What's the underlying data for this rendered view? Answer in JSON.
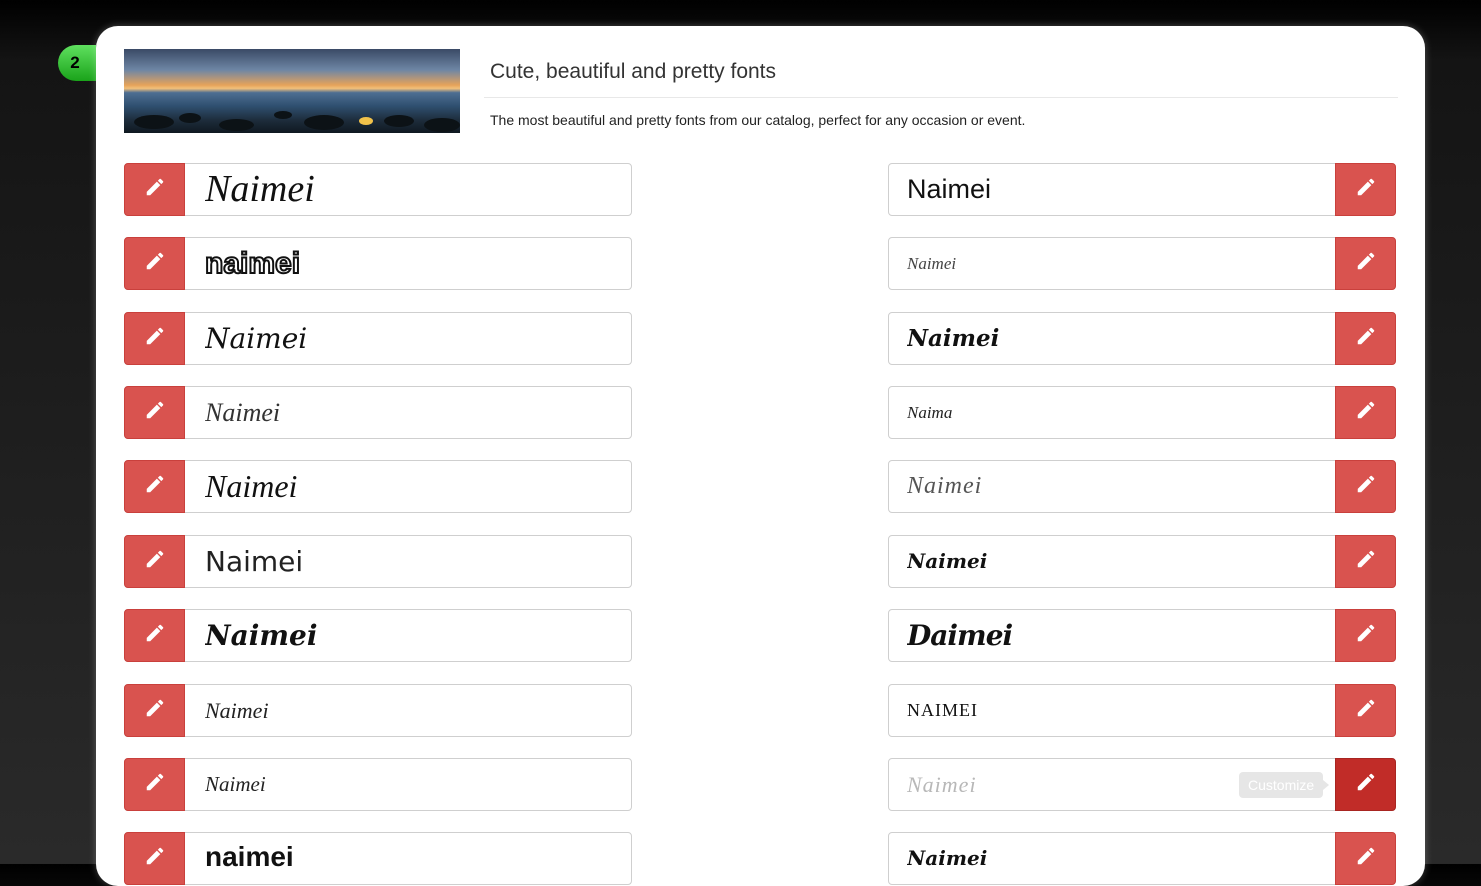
{
  "section": {
    "step_number": "2"
  },
  "header": {
    "title": "Cute, beautiful and pretty fonts",
    "description": "The most beautiful and pretty fonts from our catalog, perfect for any occasion or event."
  },
  "tooltip": {
    "label": "Customize"
  },
  "icons": {
    "edit_button": "pencil-icon"
  },
  "colors": {
    "accent": "#d9534f",
    "accent_active": "#c12c28",
    "badge": "#33c233"
  },
  "fonts_left": [
    {
      "sample": "Naimei"
    },
    {
      "sample": "naimei"
    },
    {
      "sample": "Naimei"
    },
    {
      "sample": "Naimei"
    },
    {
      "sample": "Naimei"
    },
    {
      "sample": "Naimei"
    },
    {
      "sample": "Naimei"
    },
    {
      "sample": "Naimei"
    },
    {
      "sample": "Naimei"
    },
    {
      "sample": "naimei"
    }
  ],
  "fonts_right": [
    {
      "sample": "Naimei"
    },
    {
      "sample": "Naimei"
    },
    {
      "sample": "Naimei"
    },
    {
      "sample": "Naima"
    },
    {
      "sample": "Naimei"
    },
    {
      "sample": "Naimei"
    },
    {
      "sample": "Daimei"
    },
    {
      "sample": "NAIMEI"
    },
    {
      "sample": "Naimei"
    },
    {
      "sample": "Naimei"
    }
  ]
}
